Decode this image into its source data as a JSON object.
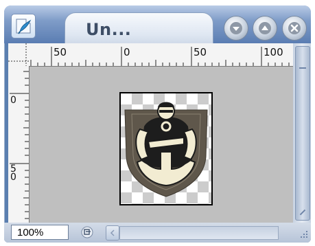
{
  "window": {
    "title": "Un...",
    "controls": [
      "minimize",
      "maximize",
      "close"
    ]
  },
  "rulers": {
    "horizontal_labels": [
      "50",
      "0",
      "50",
      "100"
    ],
    "vertical_labels": [
      "0",
      "5\n0"
    ]
  },
  "status": {
    "zoom": "100%"
  },
  "icons": {
    "app": "photoshop-feather-icon",
    "minimize": "chevron-down-icon",
    "maximize": "chevron-up-icon",
    "close": "close-icon",
    "status_menu": "status-menu-icon",
    "resize": "resize-grip-icon"
  },
  "colors": {
    "title_bar": "#5a7db2",
    "canvas_background": "#bfbfbf",
    "emblem_fill": "#f2ecd2",
    "emblem_shield": "#5f574b"
  }
}
